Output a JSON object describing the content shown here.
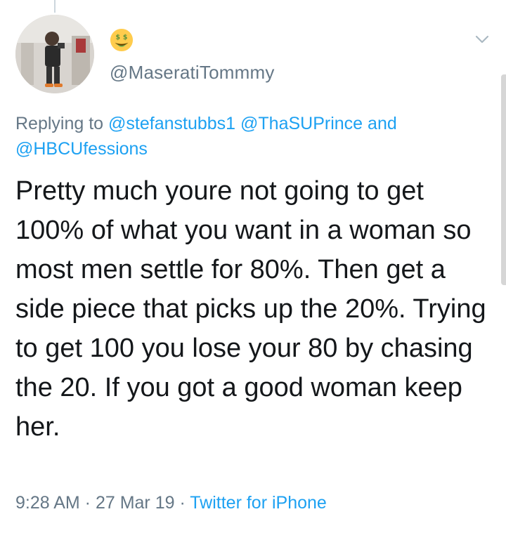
{
  "user": {
    "handle": "@MaseratiTommmy",
    "emoji_icon": "money-mouth-face-icon"
  },
  "reply": {
    "prefix": "Replying to ",
    "mentions": [
      "@stefanstubbs1",
      "@ThaSUPrince",
      "@HBCUfessions"
    ],
    "conjunction": " and "
  },
  "tweet": {
    "text": "Pretty much youre not going to get 100% of what you want in a woman so most men settle for 80%. Then get a side piece that picks up the 20%. Trying to get 100 you lose your 80 by chasing the 20. If you got a good woman keep her."
  },
  "meta": {
    "time": "9:28 AM",
    "separator": " · ",
    "date": "27 Mar 19",
    "app": "Twitter for iPhone"
  },
  "colors": {
    "link": "#1da1f2",
    "secondary": "#657786",
    "text": "#14171a"
  }
}
